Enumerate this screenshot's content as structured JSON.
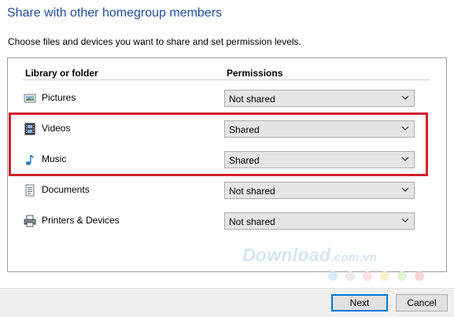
{
  "dialog": {
    "title": "Share with other homegroup members",
    "subtitle": "Choose files and devices you want to share and set permission levels."
  },
  "table": {
    "header_library": "Library or folder",
    "header_permissions": "Permissions",
    "rows": [
      {
        "label": "Pictures",
        "icon": "pictures-icon",
        "permission": "Not shared"
      },
      {
        "label": "Videos",
        "icon": "videos-icon",
        "permission": "Shared"
      },
      {
        "label": "Music",
        "icon": "music-icon",
        "permission": "Shared"
      },
      {
        "label": "Documents",
        "icon": "documents-icon",
        "permission": "Not shared"
      },
      {
        "label": "Printers & Devices",
        "icon": "printer-icon",
        "permission": "Not shared"
      }
    ]
  },
  "watermark": {
    "text": "Download",
    "domain": ".com.vn",
    "dot_colors": [
      "#d6ecf9",
      "#ececec",
      "#fbe1e1",
      "#fbf3c8",
      "#e1f4d4",
      "#cfe2f8",
      "#f9d6d6"
    ]
  },
  "buttons": {
    "next": "Next",
    "cancel": "Cancel"
  },
  "colors": {
    "title": "#1f4e9a",
    "highlight": "#d3202f",
    "default_button_border": "#0078d7"
  }
}
